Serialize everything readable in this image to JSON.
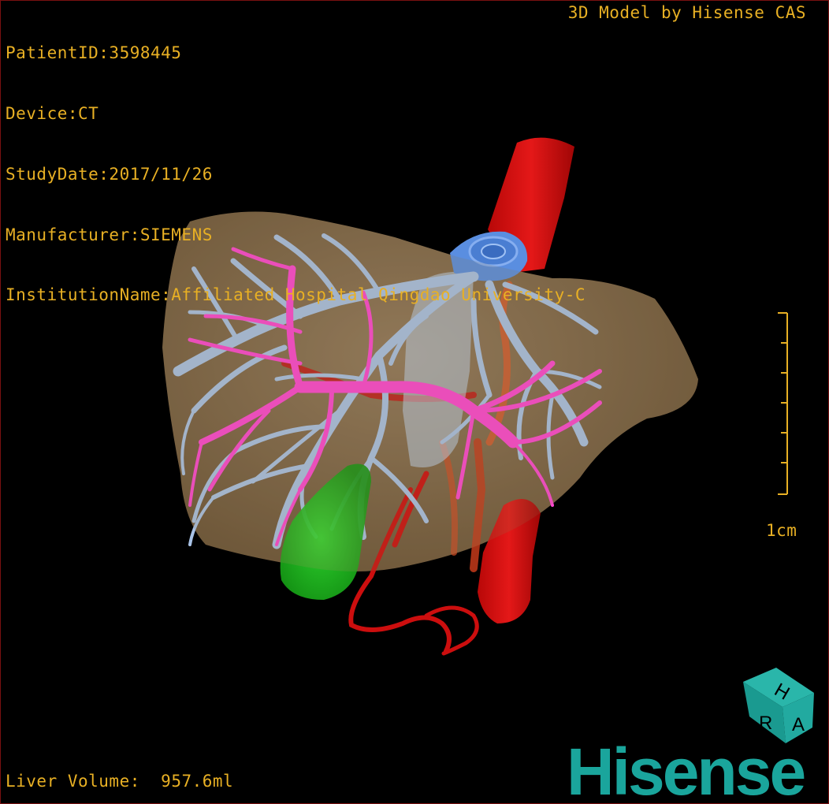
{
  "study_info": {
    "patient_id": "PatientID:3598445",
    "device": "Device:CT",
    "study_date": "StudyDate:2017/11/26",
    "manufacturer": "Manufacturer:SIEMENS",
    "institution": "InstitutionName:Affiliated Hospital Qingdao University-C"
  },
  "model_credit": "3D Model by Hisense CAS",
  "scale": {
    "label": "1cm",
    "ticks": 8
  },
  "volume": {
    "label": "Liver Volume:",
    "value": "957.6ml"
  },
  "orientation_cube": {
    "top": "H",
    "front_left": "R",
    "front_right": "A"
  },
  "logo": "Hisense",
  "colors": {
    "overlay_text": "#e8b024",
    "liver": "#8c7250",
    "hepatic_vein": "#a9c2e6",
    "portal_vein": "#ff46d2",
    "artery": "#d61010",
    "gallbladder": "#24c424",
    "ivc": "#5a8ee0",
    "brand": "#1aa59c",
    "border": "#7a1010"
  },
  "structures": [
    "liver",
    "hepatic-vein",
    "portal-vein",
    "hepatic-artery",
    "aorta",
    "gallbladder",
    "inferior-vena-cava"
  ]
}
